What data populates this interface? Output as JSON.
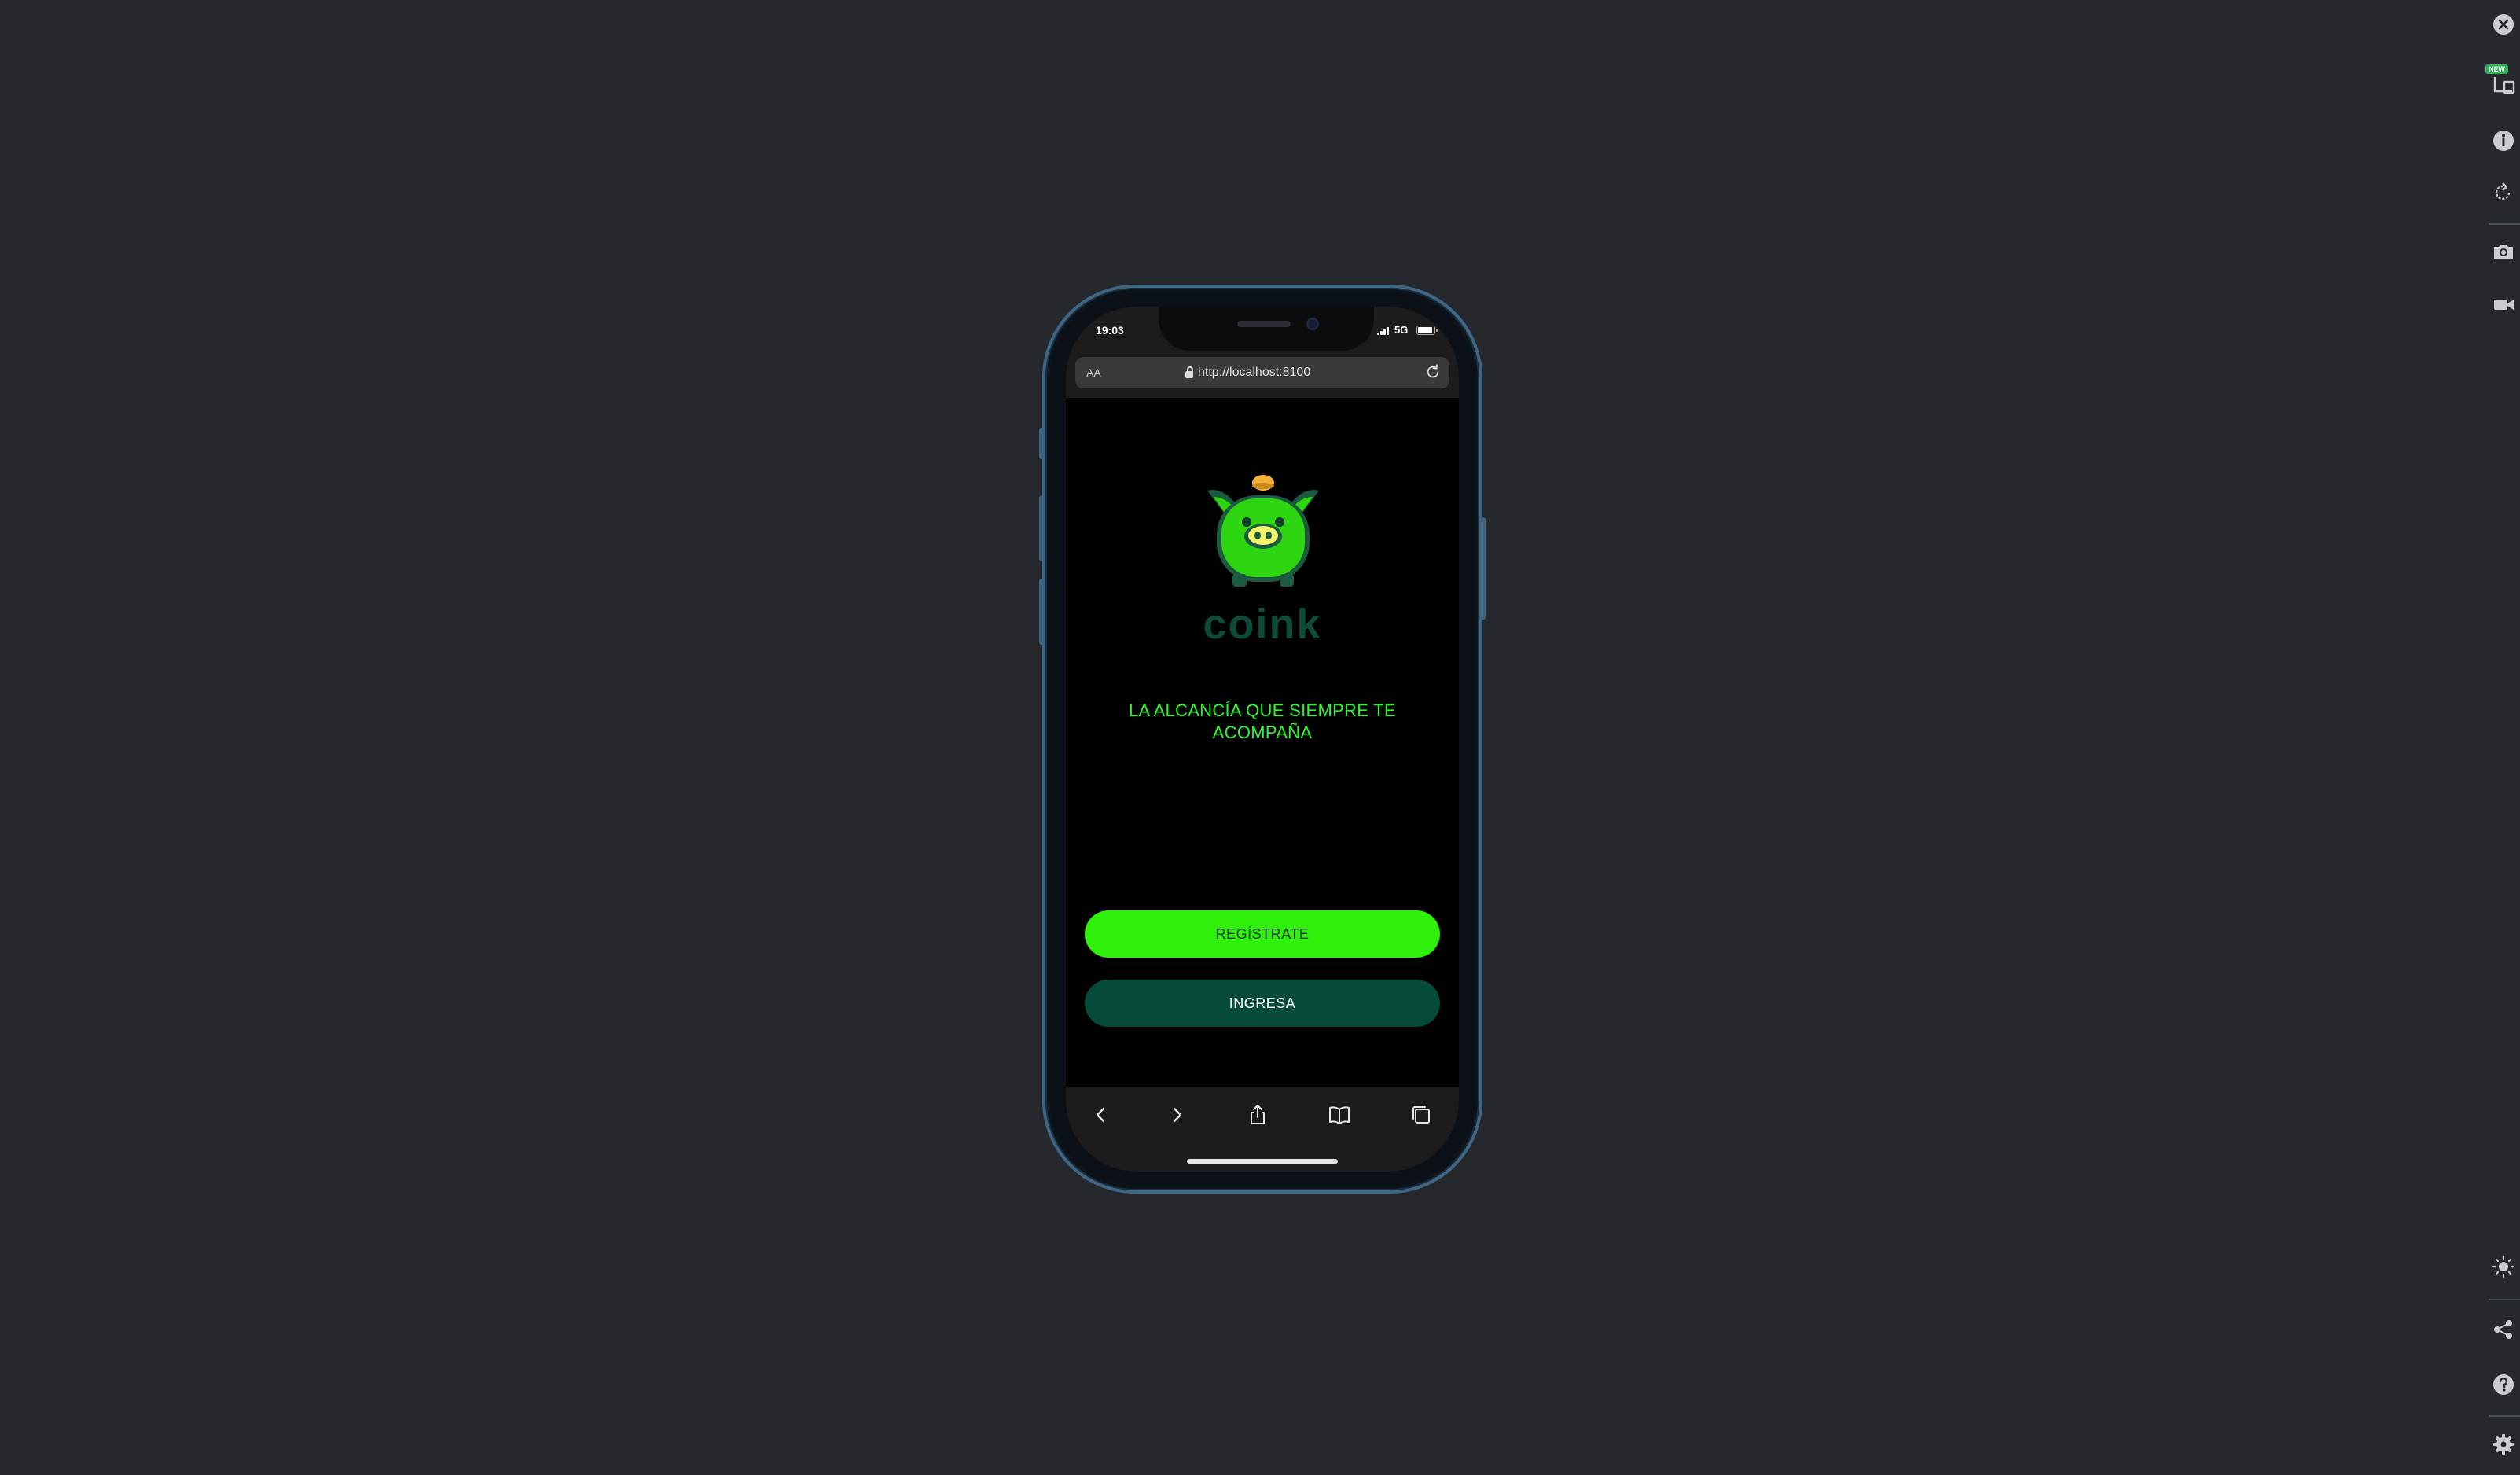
{
  "status_bar": {
    "time": "19:03",
    "network": "5G"
  },
  "browser": {
    "text_size_label": "AA",
    "url": "http://localhost:8100"
  },
  "app": {
    "brand": "COINK",
    "tagline": "LA ALCANCÍA QUE SIEMPRE TE ACOMPAÑA",
    "register_label": "REGÍSTRATE",
    "login_label": "INGRESA"
  },
  "sidebar": {
    "new_badge": "NEW"
  },
  "icons": {
    "toolbar": [
      "back-icon",
      "forward-icon",
      "share-icon",
      "bookmarks-icon",
      "tabs-icon"
    ],
    "sidebar": [
      "close-icon",
      "devices-icon",
      "info-icon",
      "rotate-icon",
      "screenshot-icon",
      "video-icon",
      "brightness-icon",
      "share-icon",
      "help-icon",
      "settings-icon"
    ]
  },
  "colors": {
    "background": "#25292e",
    "accent_green": "#2ef00a",
    "dark_green": "#064a3a",
    "tagline": "#2cf72c",
    "phone_frame": "#3f6683"
  }
}
